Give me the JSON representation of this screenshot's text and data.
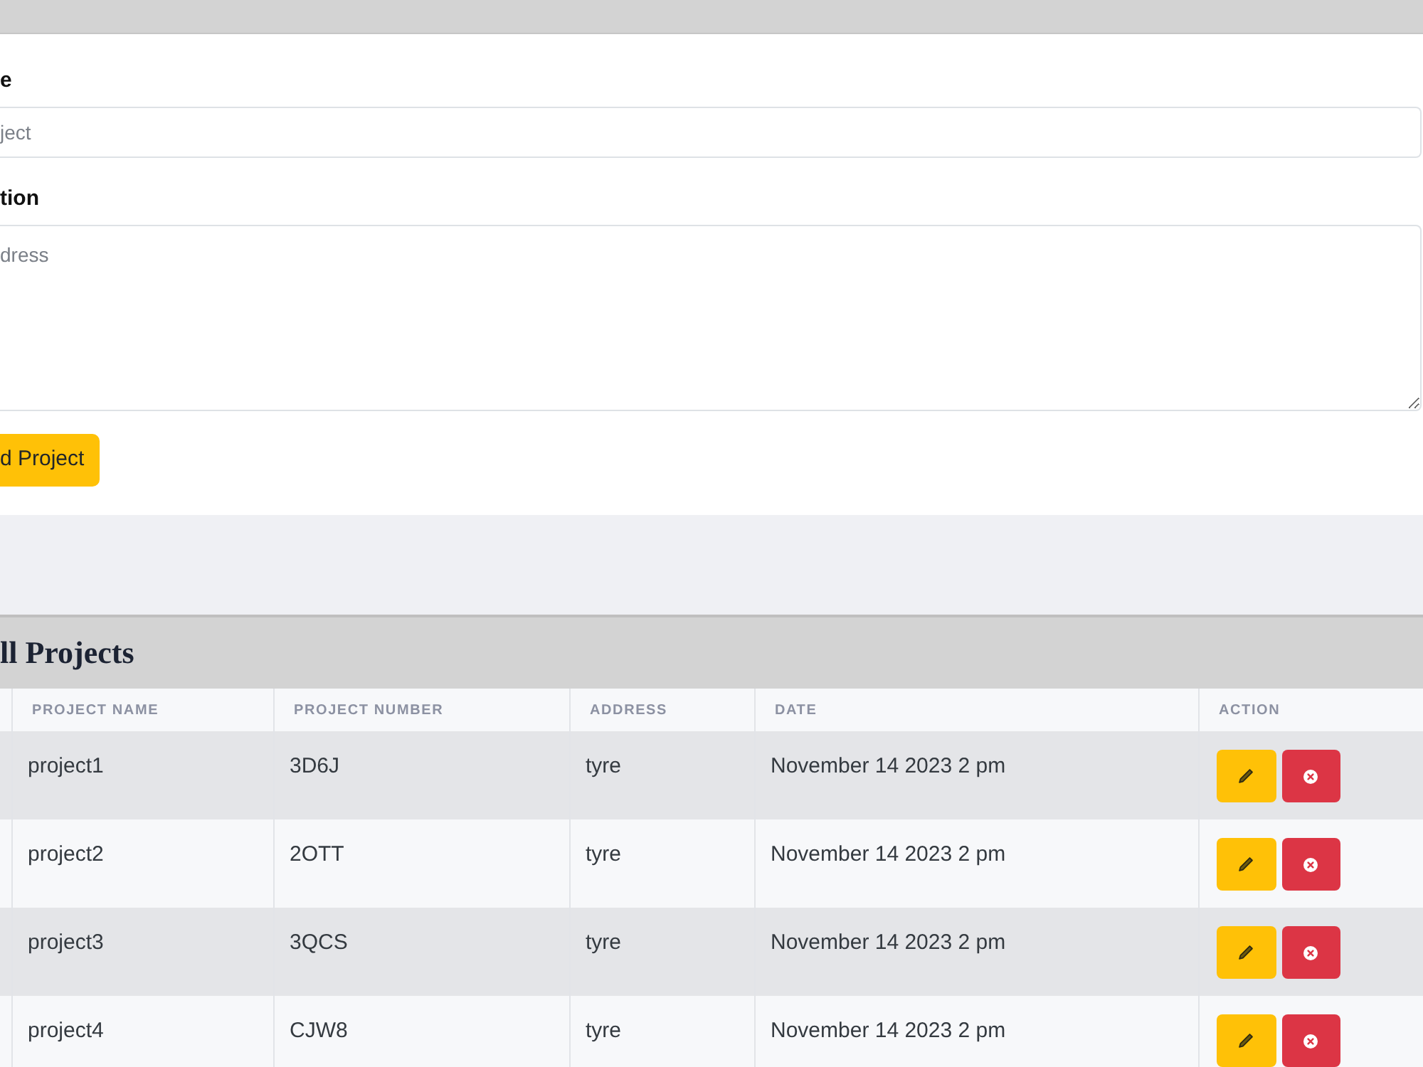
{
  "form": {
    "fields": [
      {
        "kind": "input",
        "label": "e",
        "placeholder": "ject"
      },
      {
        "kind": "textarea",
        "label": "tion",
        "placeholder": "dress"
      }
    ],
    "submit_button": "d Project"
  },
  "projects": {
    "title": "ll Projects",
    "table": {
      "columns": [
        "PROJECT NAME",
        "PROJECT NUMBER",
        "ADDRESS",
        "DATE",
        "ACTION"
      ],
      "rows": [
        {
          "cells": [
            "project1",
            "3D6J",
            "tyre",
            "November 14 2023 2 pm"
          ],
          "actions": [
            {
              "kind": "edit"
            },
            {
              "kind": "delete"
            }
          ]
        },
        {
          "cells": [
            "project2",
            "2OTT",
            "tyre",
            "November 14 2023 2 pm"
          ],
          "actions": [
            {
              "kind": "edit"
            },
            {
              "kind": "delete"
            }
          ]
        },
        {
          "cells": [
            "project3",
            "3QCS",
            "tyre",
            "November 14 2023 2 pm"
          ],
          "actions": [
            {
              "kind": "edit"
            },
            {
              "kind": "delete"
            }
          ]
        },
        {
          "cells": [
            "project4",
            "CJW8",
            "tyre",
            "November 14 2023 2 pm"
          ],
          "actions": [
            {
              "kind": "edit"
            },
            {
              "kind": "delete"
            }
          ]
        }
      ]
    }
  }
}
